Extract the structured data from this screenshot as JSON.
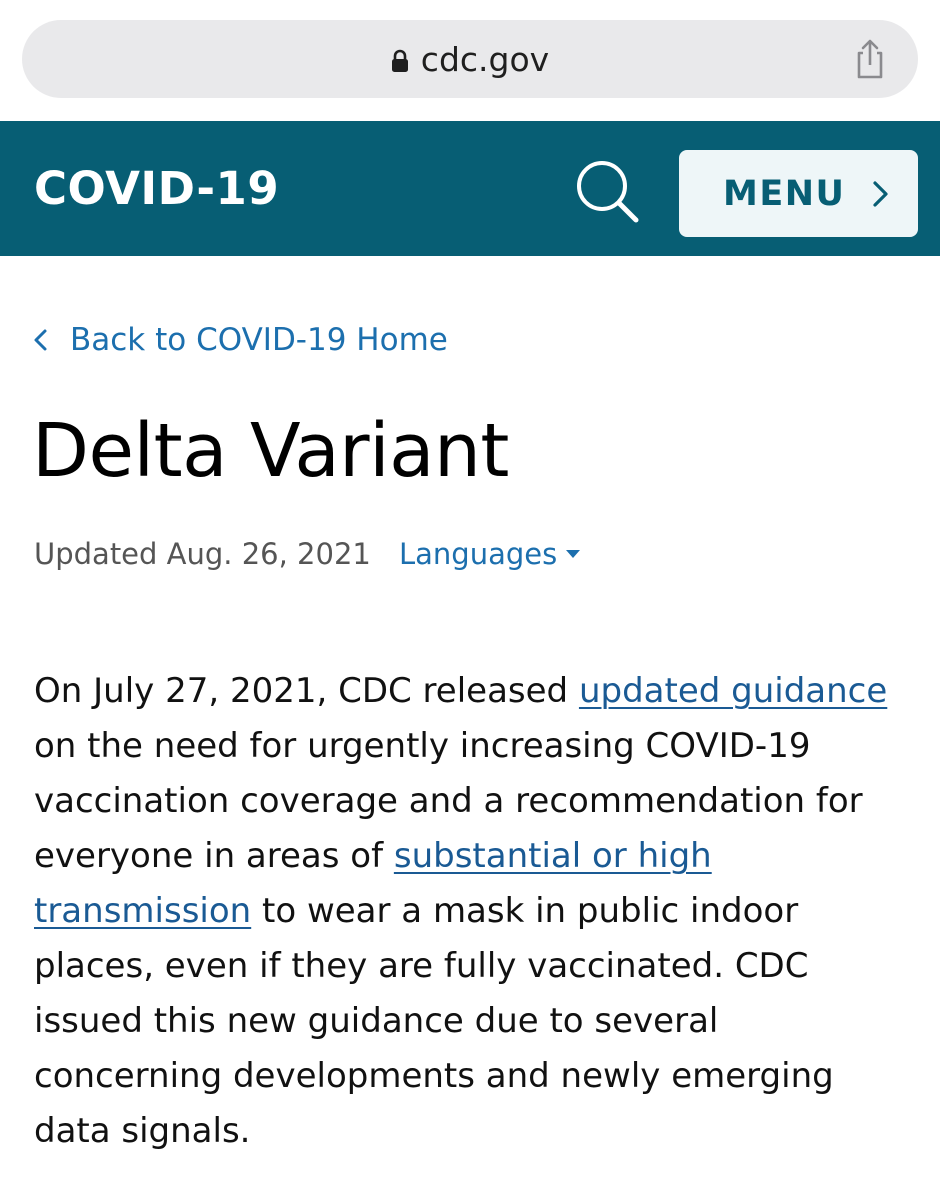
{
  "browser": {
    "url": "cdc.gov",
    "lock_icon": "lock-icon",
    "share_icon": "share-icon"
  },
  "header": {
    "title": "COVID-19",
    "search_icon": "search-icon",
    "menu_label": "MENU",
    "menu_icon": "chevron-right-icon",
    "background": "#075e74",
    "menu_background": "#eef6f8"
  },
  "nav": {
    "back_label": "Back to COVID-19 Home",
    "back_icon": "chevron-left-icon"
  },
  "page": {
    "title": "Delta Variant",
    "updated": "Updated Aug. 26, 2021",
    "languages_label": "Languages",
    "languages_icon": "caret-down-icon"
  },
  "content": {
    "lines": [
      {
        "pre": "On July 27, 2021, CDC released ",
        "link": "updated guidance",
        "post": ""
      },
      {
        "pre": "on the need for urgently increasing COVID-19",
        "link": "",
        "post": ""
      },
      {
        "pre": "vaccination coverage and a recommendation for",
        "link": "",
        "post": ""
      },
      {
        "pre": "everyone in areas of ",
        "link": "substantial or high",
        "post": ""
      },
      {
        "pre": "",
        "link": "transmission",
        "post": " to wear a mask in public indoor"
      },
      {
        "pre": "places, even if they are fully vaccinated. CDC",
        "link": "",
        "post": ""
      },
      {
        "pre": "issued this new guidance due to several",
        "link": "",
        "post": ""
      },
      {
        "pre": "concerning developments and newly emerging",
        "link": "",
        "post": ""
      },
      {
        "pre": "data signals.",
        "link": "",
        "post": ""
      }
    ],
    "link_color": "#1a5a94"
  }
}
